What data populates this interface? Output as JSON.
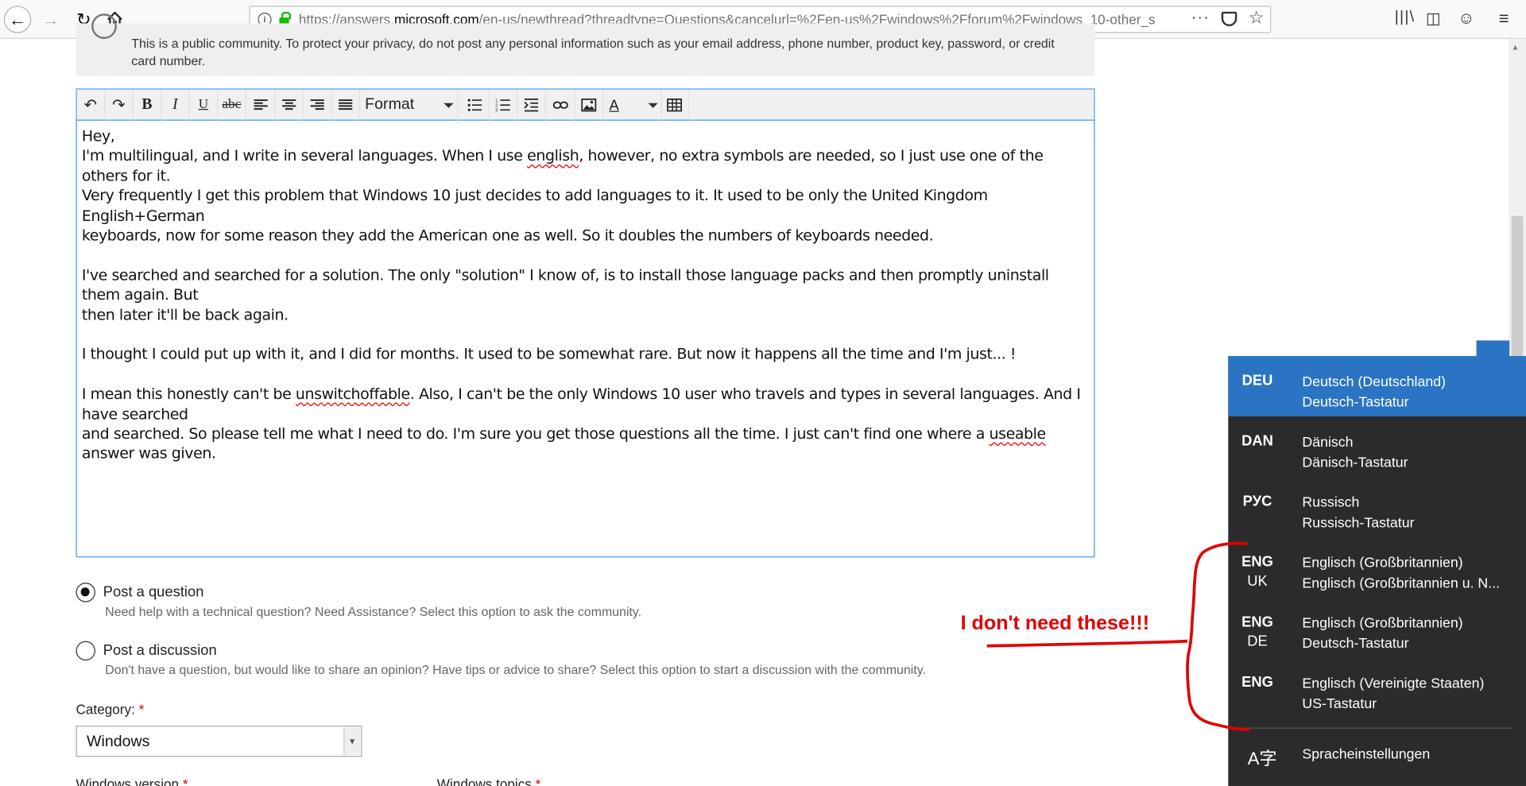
{
  "browser": {
    "url_prefix": "https://answers.",
    "url_domain": "microsoft.com",
    "url_rest": "/en-us/newthread?threadtype=Questions&cancelurl=%2Fen-us%2Fwindows%2Fforum%2Fwindows_10-other_s",
    "more_icon": "···"
  },
  "notice": {
    "line1": "This is a public community. To protect your privacy, do not post any personal information such as your email address, phone number, product key, password, or credit",
    "line2": "card number."
  },
  "toolbar": {
    "format_label": "Format",
    "icons": [
      "undo-icon",
      "redo-icon",
      "bold-icon",
      "italic-icon",
      "underline-icon",
      "strikethrough-icon",
      "align-left-icon",
      "align-center-icon",
      "align-right-icon",
      "justify-icon",
      "bullet-list-icon",
      "numbered-list-icon",
      "indent-icon",
      "link-icon",
      "image-icon",
      "text-color-icon",
      "table-icon"
    ]
  },
  "editor": {
    "p1": "Hey,",
    "p2a": "I'm multilingual, and I write in several languages. When I use ",
    "p2b": "english",
    "p2c": ", however, no extra symbols are needed, so I just use one of the others for it.",
    "p3": "Very frequently I get this problem that Windows 10 just decides to add languages to it. It used to be only the United Kingdom English+German",
    "p4": "keyboards, now for some reason they add the American one as well. So it doubles the numbers of keyboards needed.",
    "p5": "I've searched and searched for a solution. The only \"solution\" I know of, is to install those language packs and then promptly uninstall them again. But",
    "p6": "then later it'll be back again.",
    "p7": "I thought I could put up with it, and I did for months. It used to be somewhat rare. But now it happens all the time and I'm just... !",
    "p8a": "I mean this honestly can't be ",
    "p8b": "unswitchoffable",
    "p8c": ". Also, I can't be the only Windows 10 user who travels and types in several languages. And I have searched",
    "p9a": "and searched. So please tell me what I need to do. I'm sure you get those questions all the time. I just can't find one where a ",
    "p9b": "useable",
    "p9c": " answer was given."
  },
  "post_type": {
    "question_title": "Post a question",
    "question_desc": "Need help with a technical question? Need Assistance? Select this option to ask the community.",
    "discussion_title": "Post a discussion",
    "discussion_desc": "Don't have a question, but would like to share an opinion? Have tips or advice to share? Select this option to start a discussion with the community.",
    "selected": "question"
  },
  "category": {
    "label": "Category:",
    "required": "*",
    "value": "Windows"
  },
  "below": {
    "version_label": "Windows version",
    "topics_label": "Windows topics",
    "required": "*"
  },
  "language_flyout": {
    "items": [
      {
        "code": "DEU",
        "sub": "",
        "name": "Deutsch (Deutschland)",
        "keyboard": "Deutsch-Tastatur",
        "selected": true
      },
      {
        "code": "DAN",
        "sub": "",
        "name": "Dänisch",
        "keyboard": "Dänisch-Tastatur",
        "selected": false
      },
      {
        "code": "РУС",
        "sub": "",
        "name": "Russisch",
        "keyboard": "Russisch-Tastatur",
        "selected": false
      },
      {
        "code": "ENG",
        "sub": "UK",
        "name": "Englisch (Großbritannien)",
        "keyboard": "Englisch (Großbritannien u. N...",
        "selected": false
      },
      {
        "code": "ENG",
        "sub": "DE",
        "name": "Englisch (Großbritannien)",
        "keyboard": "Deutsch-Tastatur",
        "selected": false
      },
      {
        "code": "ENG",
        "sub": "",
        "name": "Englisch (Vereinigte Staaten)",
        "keyboard": "US-Tastatur",
        "selected": false
      }
    ],
    "settings_label": "Spracheinstellungen",
    "settings_icon": "A字"
  },
  "annotation": {
    "text": "I don't need these!!!",
    "color": "#e00000"
  }
}
